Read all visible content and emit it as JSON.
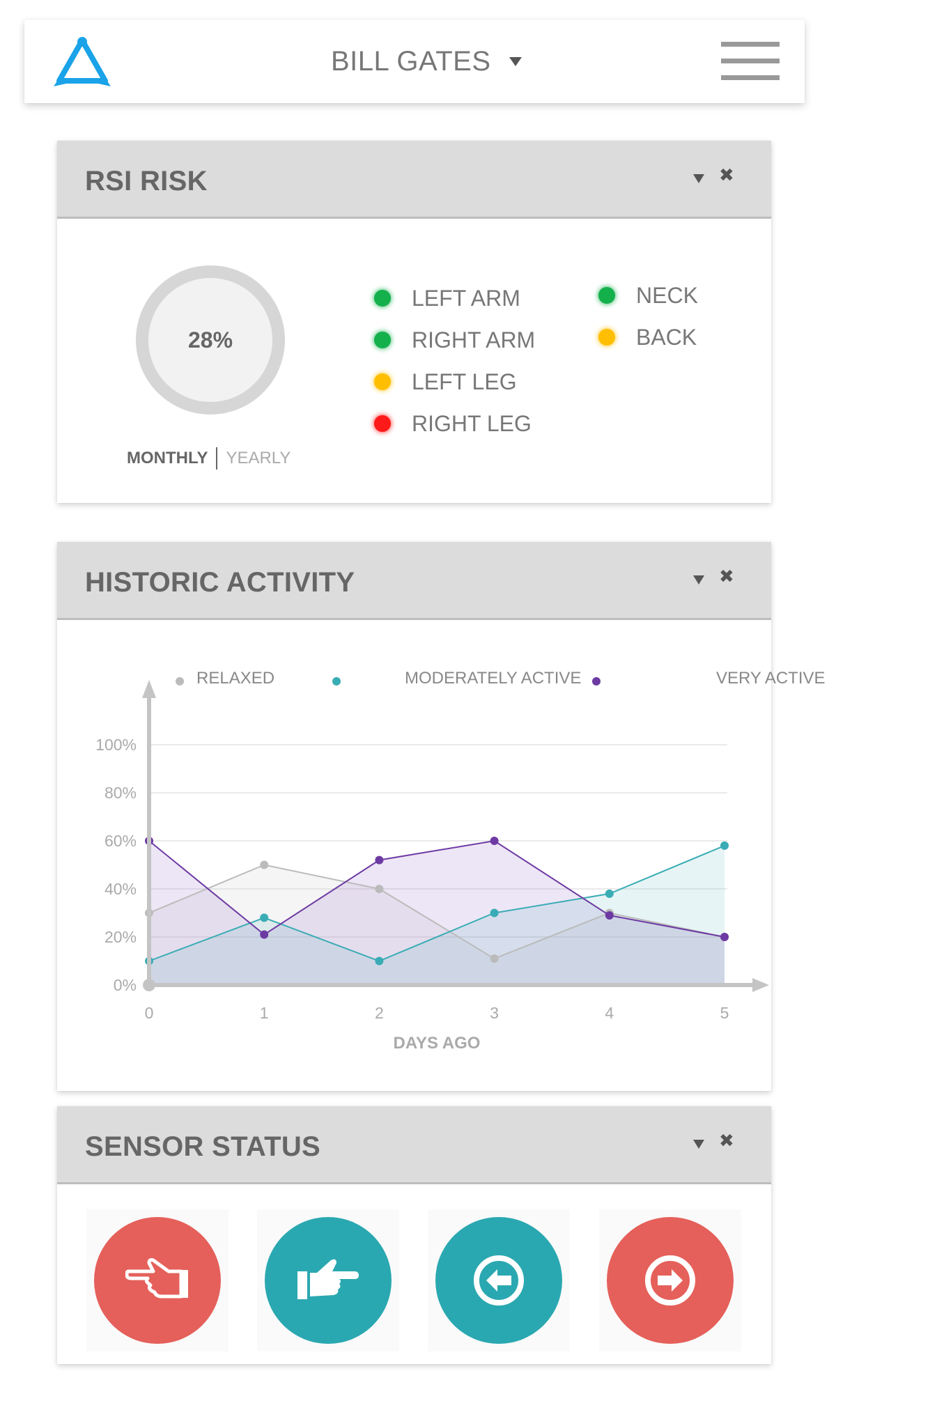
{
  "header": {
    "user_name": "BILL GATES",
    "logo_icon": "app-logo-triangle",
    "menu_icon": "hamburger-menu-icon",
    "accent_color": "#1aa3e8"
  },
  "rsi_panel": {
    "title": "RSI RISK",
    "risk_value": "28%",
    "period_options": {
      "monthly": "MONTHLY",
      "yearly": "YEARLY"
    },
    "active_period": "MONTHLY",
    "body_parts": [
      {
        "label": "LEFT ARM",
        "status_color": "#14b04c"
      },
      {
        "label": "RIGHT ARM",
        "status_color": "#14b04c"
      },
      {
        "label": "LEFT LEG",
        "status_color": "#ffbf00"
      },
      {
        "label": "RIGHT LEG",
        "status_color": "#ff1a1a"
      },
      {
        "label": "NECK",
        "status_color": "#14b04c"
      },
      {
        "label": "BACK",
        "status_color": "#ffbf00"
      }
    ]
  },
  "activity_panel": {
    "title": "HISTORIC ACTIVITY"
  },
  "chart_data": {
    "type": "area",
    "title": "",
    "xlabel": "DAYS AGO",
    "ylabel": "",
    "x": [
      0,
      1,
      2,
      3,
      4,
      5
    ],
    "xticks": [
      "0",
      "1",
      "2",
      "3",
      "4",
      "5"
    ],
    "yticks": [
      "0%",
      "20%",
      "40%",
      "60%",
      "80%",
      "100%"
    ],
    "ylim": [
      0,
      100
    ],
    "grid": true,
    "legend_position": "top",
    "series": [
      {
        "name": "RELAXED",
        "color": "#bbbbbb",
        "values": [
          30,
          50,
          40,
          11,
          30,
          20
        ]
      },
      {
        "name": "MODERATELY ACTIVE",
        "color": "#3aacb5",
        "values": [
          10,
          28,
          10,
          30,
          38,
          58
        ]
      },
      {
        "name": "VERY ACTIVE",
        "color": "#6d3aa3",
        "values": [
          60,
          21,
          52,
          60,
          29,
          20
        ]
      }
    ]
  },
  "sensor_panel": {
    "title": "SENSOR STATUS",
    "buttons": [
      {
        "icon": "hand-point-left-icon",
        "color": "#e5605a"
      },
      {
        "icon": "hand-point-right-icon",
        "color": "#2aa8b1"
      },
      {
        "icon": "arrow-circle-left-icon",
        "color": "#2aa8b1"
      },
      {
        "icon": "arrow-circle-right-icon",
        "color": "#e5605a"
      }
    ]
  }
}
